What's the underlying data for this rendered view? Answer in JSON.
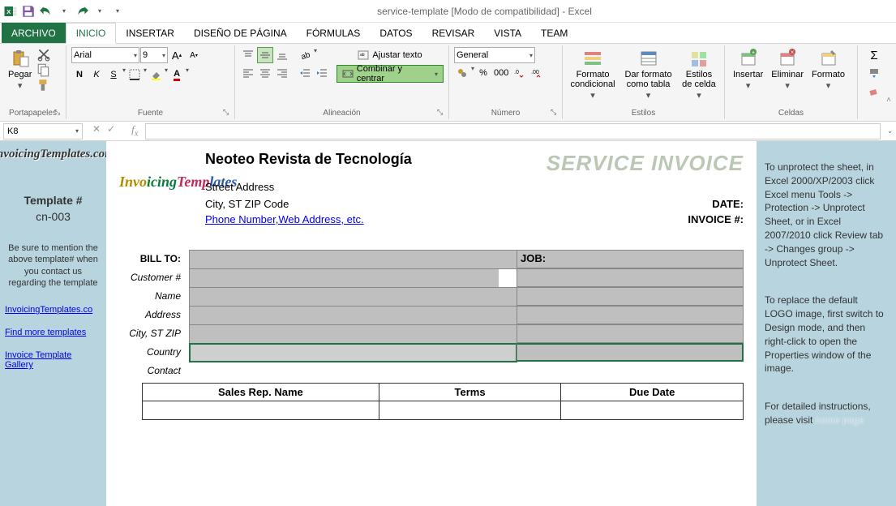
{
  "window": {
    "title": "service-template  [Modo de compatibilidad] - Excel"
  },
  "tabs": {
    "file": "ARCHIVO",
    "home": "INICIO",
    "insert": "INSERTAR",
    "pagelayout": "DISEÑO DE PÁGINA",
    "formulas": "FÓRMULAS",
    "data": "DATOS",
    "review": "REVISAR",
    "view": "VISTA",
    "team": "TEAM"
  },
  "ribbon": {
    "clipboard": {
      "label": "Portapapeles",
      "paste": "Pegar"
    },
    "font": {
      "label": "Fuente",
      "name": "Arial",
      "size": "9",
      "bold": "N",
      "italic": "K",
      "underline": "S"
    },
    "align": {
      "label": "Alineación",
      "wrap": "Ajustar texto",
      "merge": "Combinar y centrar"
    },
    "number": {
      "label": "Número",
      "format": "General",
      "pct": "%",
      "comma": "000"
    },
    "styles": {
      "label": "Estilos",
      "cond": "Formato condicional",
      "table": "Dar formato como tabla",
      "cell": "Estilos de celda"
    },
    "cells": {
      "label": "Celdas",
      "insert": "Insertar",
      "delete": "Eliminar",
      "format": "Formato"
    }
  },
  "namebox": "K8",
  "leftPanel": {
    "tplLabel": "Template #",
    "tplNum": "cn-003",
    "note": "Be sure to mention the above template# when you contact us regarding the template",
    "link1": "InvoicingTemplates.co",
    "link2": "Find more templates",
    "link3": "Invoice Template Gallery"
  },
  "invoice": {
    "company": "Neoteo Revista de Tecnología",
    "title": "SERVICE INVOICE",
    "street": "Street Address",
    "city": "City, ST  ZIP Code",
    "phone": "Phone Number,Web Address, etc.",
    "dateLbl": "DATE:",
    "invLbl": "INVOICE #:",
    "billto": "BILL TO:",
    "job": "JOB:",
    "custno": "Customer #",
    "name": "Name",
    "addr": "Address",
    "czip": "City, ST ZIP",
    "country": "Country",
    "contact": "Contact",
    "sales": "Sales Rep. Name",
    "terms": "Terms",
    "due": "Due Date"
  },
  "rightPanel": {
    "p1": "To unprotect the sheet, in Excel 2000/XP/2003 click Excel menu Tools -> Protection -> Unprotect Sheet, or in Excel 2007/2010 click Review tab -> Changes group -> Unprotect Sheet.",
    "p2": "To replace the default LOGO image, first switch to Design mode, and then right-click to open the Properties window of the image.",
    "p3a": "For detailed instructions, please visit ",
    "p3link": "home page"
  }
}
